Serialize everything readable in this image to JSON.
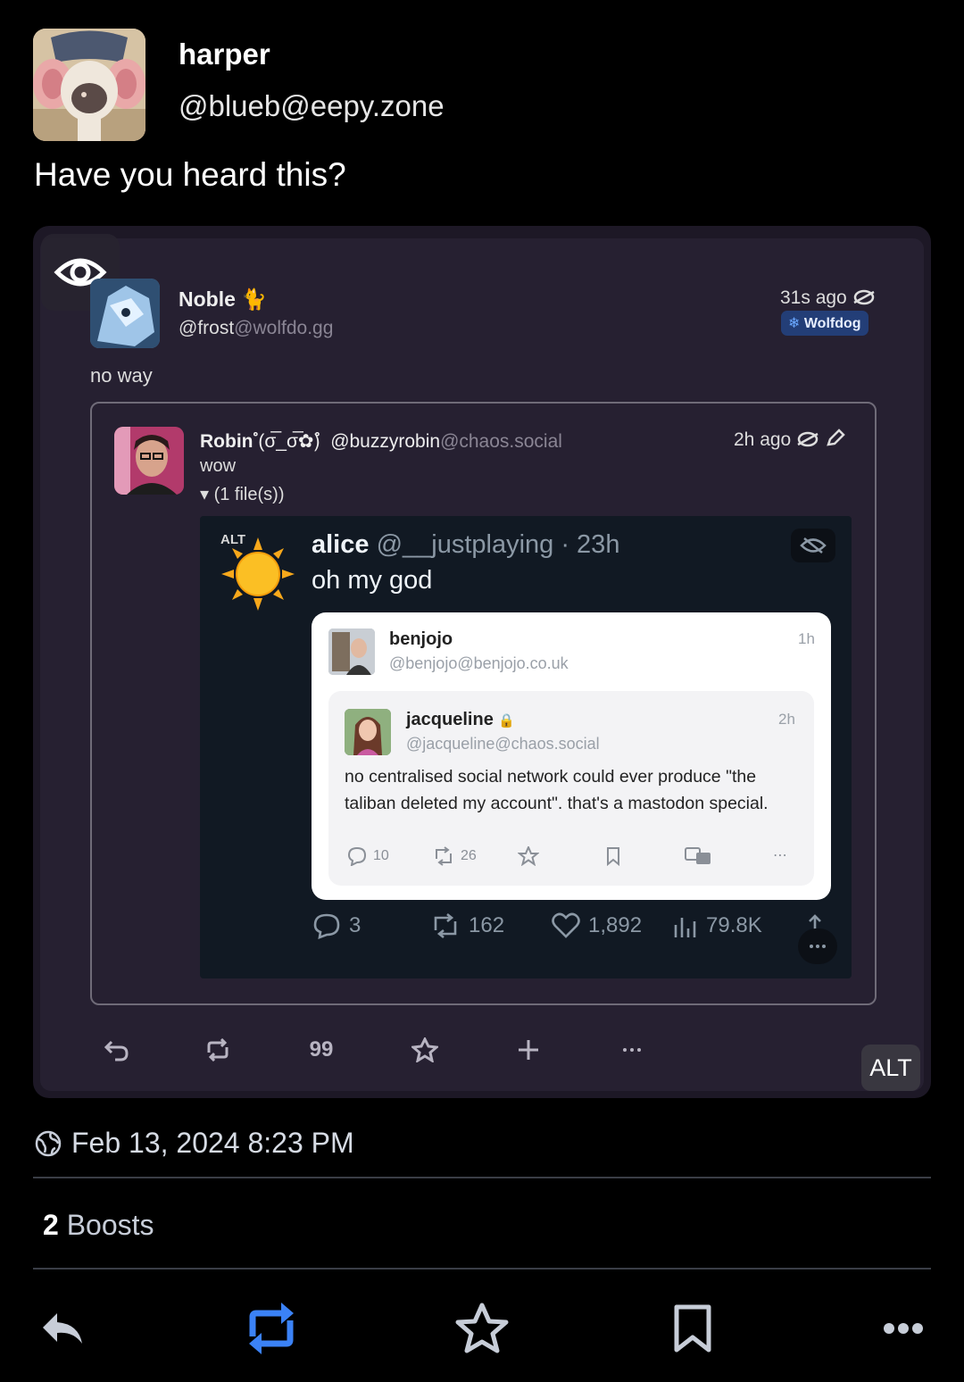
{
  "post": {
    "author_name": "harper",
    "author_handle": "@blueb@eepy.zone",
    "text": "Have you heard this?",
    "timestamp": "Feb 13, 2024 8:23 PM",
    "boost_count": "2",
    "boost_label": "Boosts"
  },
  "media": {
    "alt_label": "ALT",
    "noble": {
      "name": "Noble",
      "handle_user": "@frost",
      "handle_domain": "@wolfdo.gg",
      "time": "31s ago",
      "badge": "Wolfdog",
      "text": "no way"
    },
    "robin": {
      "name": "Robin",
      "kaomoji": "ํ(σ̅_σ̅✿)ํ",
      "handle_user": "@buzzyrobin",
      "handle_domain": "@chaos.social",
      "time": "2h ago",
      "text": "wow",
      "files": "▾ (1 file(s))"
    },
    "tweet": {
      "alt": "ALT",
      "name": "alice",
      "handle": "@__justplaying · 23h",
      "text": "oh my god",
      "replies": "3",
      "retweets": "162",
      "likes": "1,892",
      "views": "79.8K"
    },
    "benjojo": {
      "name": "benjojo",
      "handle": "@benjojo@benjojo.co.uk",
      "time": "1h"
    },
    "jacqueline": {
      "name": "jacqueline",
      "handle": "@jacqueline@chaos.social",
      "time": "2h",
      "text": "no centralised social network could ever produce \"the taliban deleted my account\". that's a mastodon special.",
      "replies": "10",
      "boosts": "26"
    },
    "quote_label": "99"
  },
  "icons": {
    "globe": "globe-icon",
    "reply": "reply-icon",
    "boost": "boost-icon",
    "favourite": "star-icon",
    "bookmark": "bookmark-icon",
    "more": "more-icon"
  },
  "colors": {
    "accent_boost": "#3b82f6",
    "background": "#000000",
    "badge": "#233e77"
  }
}
